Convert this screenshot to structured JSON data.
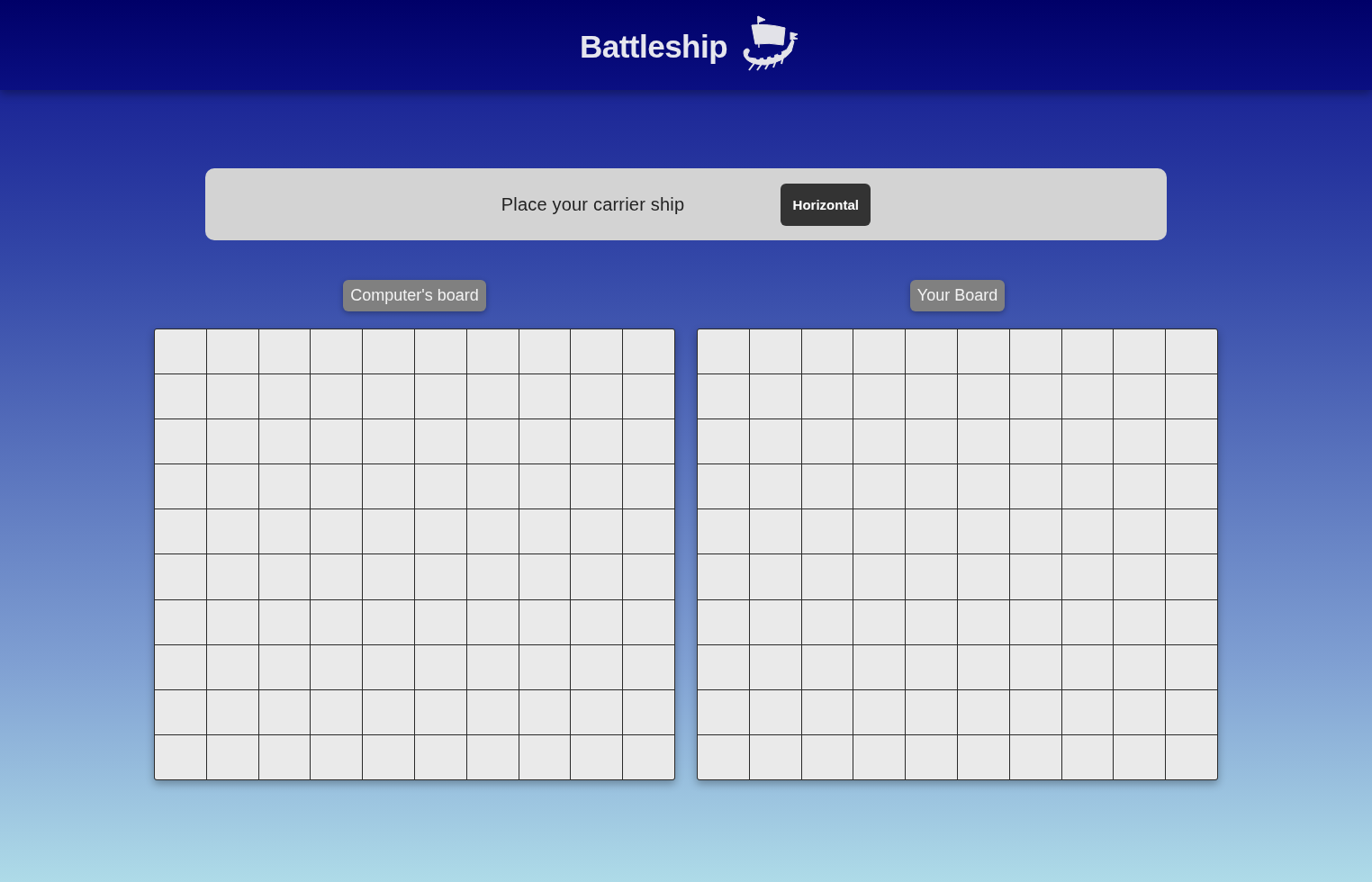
{
  "header": {
    "title": "Battleship"
  },
  "instruction_panel": {
    "message": "Place your carrier ship",
    "orientation_button": "Horizontal"
  },
  "boards": [
    {
      "label": "Computer's board"
    },
    {
      "label": "Your Board"
    }
  ]
}
